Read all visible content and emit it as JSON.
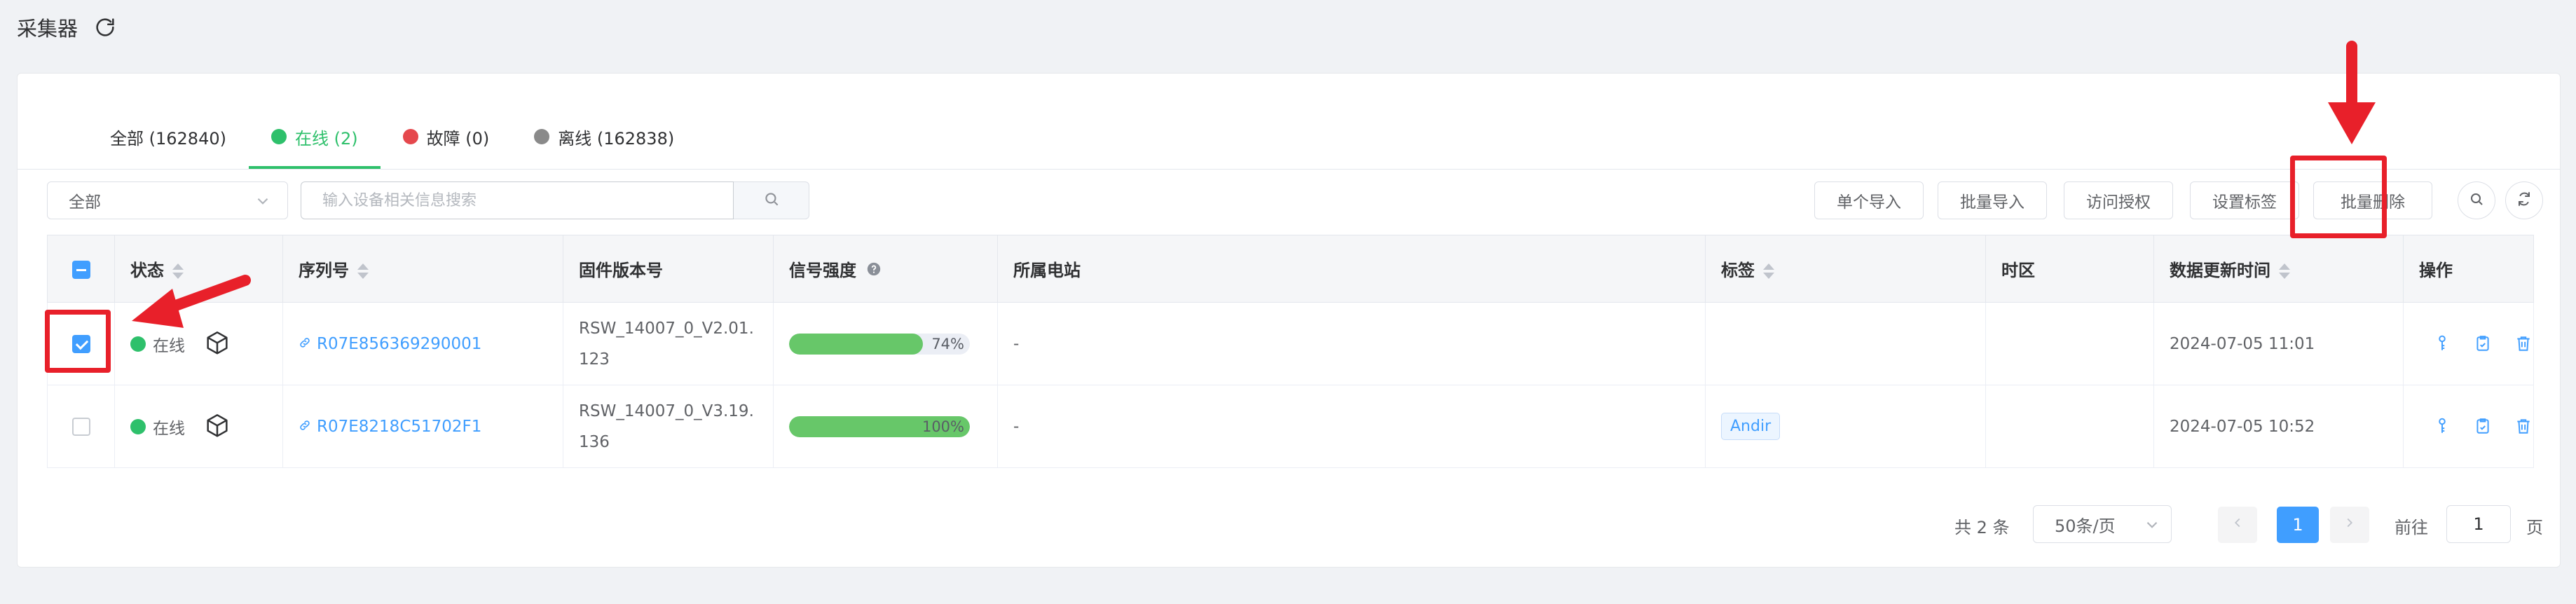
{
  "header": {
    "title": "采集器",
    "refresh_icon": "refresh-icon"
  },
  "tabs": [
    {
      "label": "全部 (162840)",
      "dot_color": ""
    },
    {
      "label": "在线 (2)",
      "dot_color": "#2ec06b",
      "active": true
    },
    {
      "label": "故障 (0)",
      "dot_color": "#e5484d"
    },
    {
      "label": "离线 (162838)",
      "dot_color": "#8a8a8a"
    }
  ],
  "filter": {
    "selected": "全部"
  },
  "search": {
    "placeholder": "输入设备相关信息搜索",
    "value": ""
  },
  "toolbar": {
    "single_import": "单个导入",
    "batch_import": "批量导入",
    "access_auth": "访问授权",
    "set_tag": "设置标签",
    "batch_delete": "批量删除"
  },
  "table": {
    "columns": {
      "status": "状态",
      "serial": "序列号",
      "firmware": "固件版本号",
      "signal": "信号强度",
      "station": "所属电站",
      "tag": "标签",
      "timezone": "时区",
      "updated": "数据更新时间",
      "actions": "操作"
    },
    "rows": [
      {
        "checked": true,
        "status": "在线",
        "serial": "R07E856369290001",
        "firmware": "RSW_14007_0_V2.01.123",
        "signal_pct": 74,
        "signal_label": "74%",
        "station": "-",
        "tag": "",
        "timezone": "",
        "updated": "2024-07-05 11:01"
      },
      {
        "checked": false,
        "status": "在线",
        "serial": "R07E8218C51702F1",
        "firmware": "RSW_14007_0_V3.19.136",
        "signal_pct": 100,
        "signal_label": "100%",
        "station": "-",
        "tag": "Andir",
        "timezone": "",
        "updated": "2024-07-05 10:52"
      }
    ]
  },
  "pagination": {
    "total": "共 2 条",
    "page_size": "50条/页",
    "current": "1",
    "goto_prefix": "前往",
    "goto_value": "1",
    "goto_suffix": "页"
  },
  "colors": {
    "accent": "#409eff",
    "online": "#2ec06b",
    "highlight": "#e8202a"
  }
}
